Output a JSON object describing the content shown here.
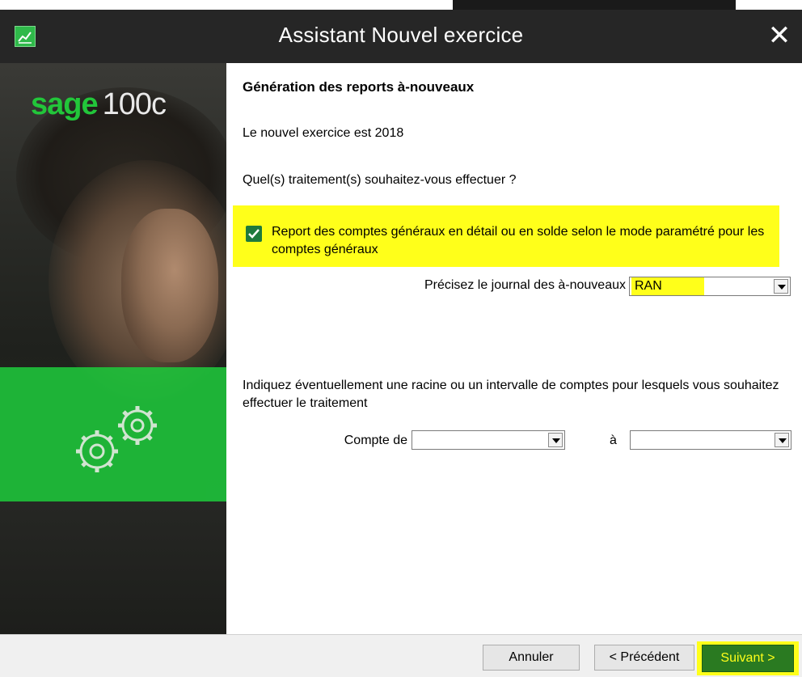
{
  "window": {
    "title": "Assistant Nouvel exercice",
    "close_glyph": "✕"
  },
  "branding": {
    "logo_word": "sage",
    "logo_number": "100c",
    "icons": [
      "app-chart-icon",
      "gears-icon"
    ]
  },
  "content": {
    "heading": "Génération des reports à-nouveaux",
    "new_year_text": "Le nouvel exercice est 2018",
    "question": "Quel(s) traitement(s) souhaitez-vous effectuer ?",
    "checkbox": {
      "checked": true,
      "label": "Report des comptes généraux en détail ou en solde selon le mode paramétré pour les comptes généraux"
    },
    "journal": {
      "label": "Précisez le journal des à-nouveaux",
      "value": "RAN"
    },
    "range_hint": "Indiquez éventuellement une racine ou un intervalle de comptes pour lesquels vous souhaitez effectuer le traitement",
    "account_from": {
      "label": "Compte de",
      "value": ""
    },
    "account_to": {
      "label": "à",
      "value": ""
    }
  },
  "footer": {
    "cancel": "Annuler",
    "previous": "< Précédent",
    "next": "Suivant >"
  },
  "colors": {
    "accent_green": "#1ec73b",
    "highlight_yellow": "#ffff1a",
    "next_button": "#2a7a21"
  }
}
